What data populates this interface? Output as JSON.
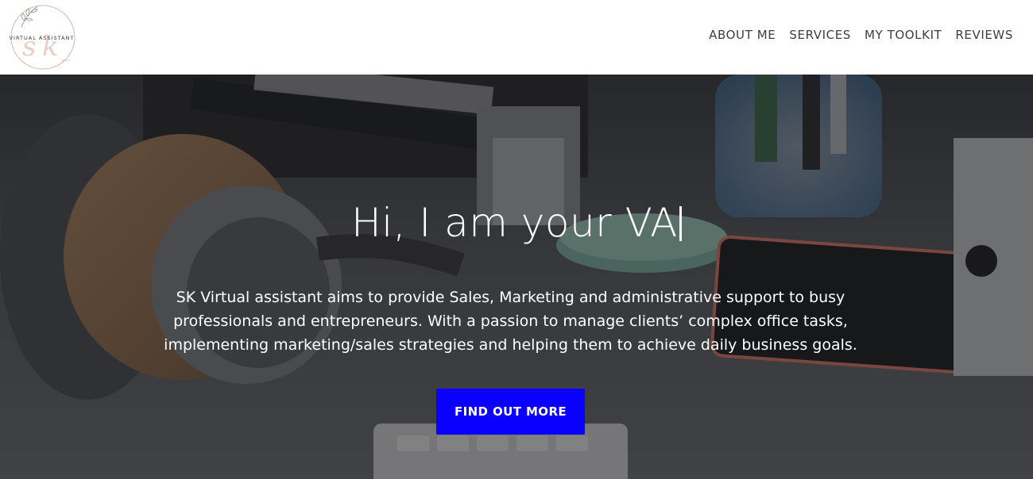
{
  "logo": {
    "monogram": "sk",
    "text": "VIRTUAL ASSISTANT",
    "accent_color": "#d9b7a8"
  },
  "nav": {
    "items": [
      {
        "label": "ABOUT ME"
      },
      {
        "label": "SERVICES"
      },
      {
        "label": "MY TOOLKIT"
      },
      {
        "label": "REVIEWS"
      }
    ]
  },
  "hero": {
    "title": "Hi, I am your VA",
    "description": "SK Virtual assistant aims to provide Sales, Marketing and administrative support to busy professionals and entrepreneurs. With a passion to manage clients’ complex office tasks, implementing marketing/sales strategies and helping them to achieve daily business goals.",
    "cta_label": "FIND OUT MORE",
    "cta_color": "#0a00ff",
    "background_image": "desk-headphones-photo"
  }
}
